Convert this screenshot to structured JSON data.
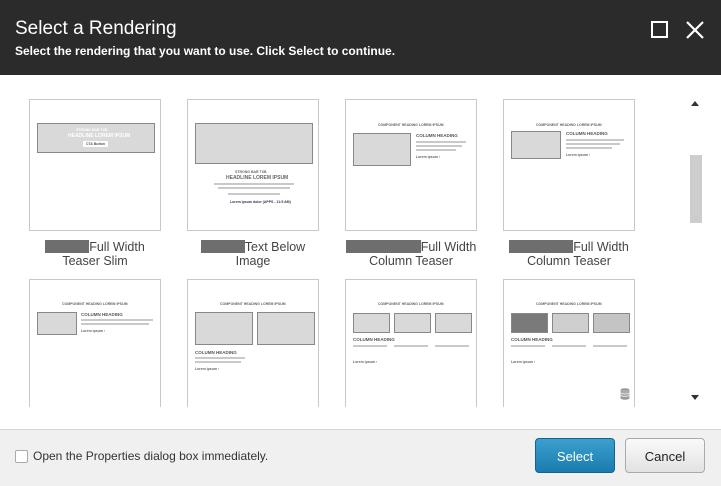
{
  "dialog": {
    "title": "Select a Rendering",
    "subtitle": "Select the rendering that you want to use. Click Select to continue."
  },
  "window_buttons": {
    "maximize": "maximize-icon",
    "close": "close-icon"
  },
  "renderings": [
    {
      "caption_line1": "Full Width",
      "caption_line2": "Teaser Slim",
      "preview": {
        "eyebrow": "STRONG BAR TXB",
        "headline": "HEADLINE LOREM IPSUM",
        "button": "CTA Button"
      }
    },
    {
      "caption_line1": "Text Below",
      "caption_line2": "Image",
      "preview": {
        "eyebrow": "STRONG BAR TXB",
        "headline": "HEADLINE LOREM IPSUM",
        "link": "Lorem ipsum dolor (APPS - 11:5 AM)"
      }
    },
    {
      "caption_line1": "Full Width",
      "caption_line2": "Column Teaser",
      "preview": {
        "heading": "COMPONENT HEADING LOREM IPSUM",
        "column_heading": "COLUMN HEADING",
        "link": "Lorem ipsum ›"
      }
    },
    {
      "caption_line1": "Full Width",
      "caption_line2": "Column Teaser",
      "preview": {
        "heading": "COMPONENT HEADING LOREM IPSUM",
        "column_heading": "COLUMN HEADING",
        "link": "Lorem ipsum ›"
      }
    },
    {
      "preview": {
        "heading": "COMPONENT HEADING LOREM IPSUM",
        "column_heading": "COLUMN HEADING",
        "link": "Lorem ipsum ›"
      }
    },
    {
      "preview": {
        "heading": "COMPONENT HEADING LOREM IPSUM",
        "column_heading": "COLUMN HEADING",
        "link": "Lorem ipsum ›"
      }
    },
    {
      "preview": {
        "heading": "COMPONENT HEADING LOREM IPSUM",
        "column_heading": "COLUMN HEADING",
        "link": "Lorem ipsum ›"
      }
    },
    {
      "preview": {
        "heading": "COMPONENT HEADING LOREM IPSUM",
        "column_heading": "COLUMN HEADING",
        "link": "Lorem ipsum ›"
      }
    }
  ],
  "footer": {
    "checkbox_label": "Open the Properties dialog box immediately.",
    "checkbox_checked": false,
    "select_label": "Select",
    "cancel_label": "Cancel"
  },
  "colors": {
    "titlebar": "#2b2b2b",
    "select_button": "#2389bd",
    "footer": "#f0f0f0"
  }
}
